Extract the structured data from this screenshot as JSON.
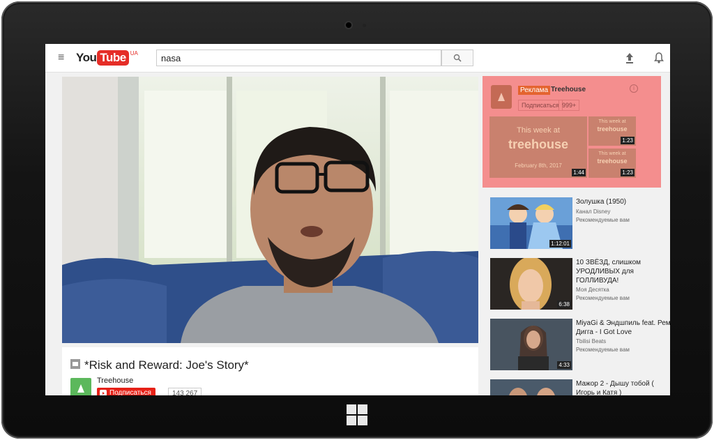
{
  "header": {
    "logo_you": "You",
    "logo_tube": "Tube",
    "logo_region": "UA",
    "search_value": "nasa"
  },
  "video": {
    "title": "*Risk and Reward: Joe's Story*",
    "channel": "Treehouse",
    "subscribe_label": "Подписаться",
    "subscriber_count": "143 267"
  },
  "ad": {
    "badge": "Реклама",
    "channel": "Treehouse",
    "subscribe_label": "Подписаться",
    "subscriber_count": "999+",
    "big_card": {
      "line1": "This week at",
      "line2": "treehouse",
      "date": "February 8th, 2017",
      "duration": "1:44"
    },
    "small_cards": [
      {
        "line1": "This week at",
        "line2": "treehouse",
        "duration": "1:23"
      },
      {
        "line1": "This week at",
        "line2": "treehouse",
        "duration": "1:23"
      }
    ]
  },
  "recommended": [
    {
      "title": "Золушка (1950)",
      "channel": "Канал Disney",
      "note": "Рекомендуемые вам",
      "duration": "1:12:01"
    },
    {
      "title": "10 ЗВЁЗД, слишком УРОДЛИВЫХ для ГОЛЛИВУДА!",
      "channel": "Моя Десятка",
      "note": "Рекомендуемые вам",
      "duration": "6:38"
    },
    {
      "title": "MiyaGi & Эндшпиль feat. Рем Дигга - I Got Love",
      "channel": "Tbilisi Beats",
      "note": "Рекомендуемые вам",
      "duration": "4:33"
    },
    {
      "title": "Мажор 2 - Дышу тобой ( Игорь и Катя )",
      "channel": "",
      "note": "",
      "duration": ""
    }
  ],
  "colors": {
    "brand_red": "#e52d27",
    "ad_highlight": "#f48e8e",
    "treehouse_green": "#5cb85c"
  }
}
